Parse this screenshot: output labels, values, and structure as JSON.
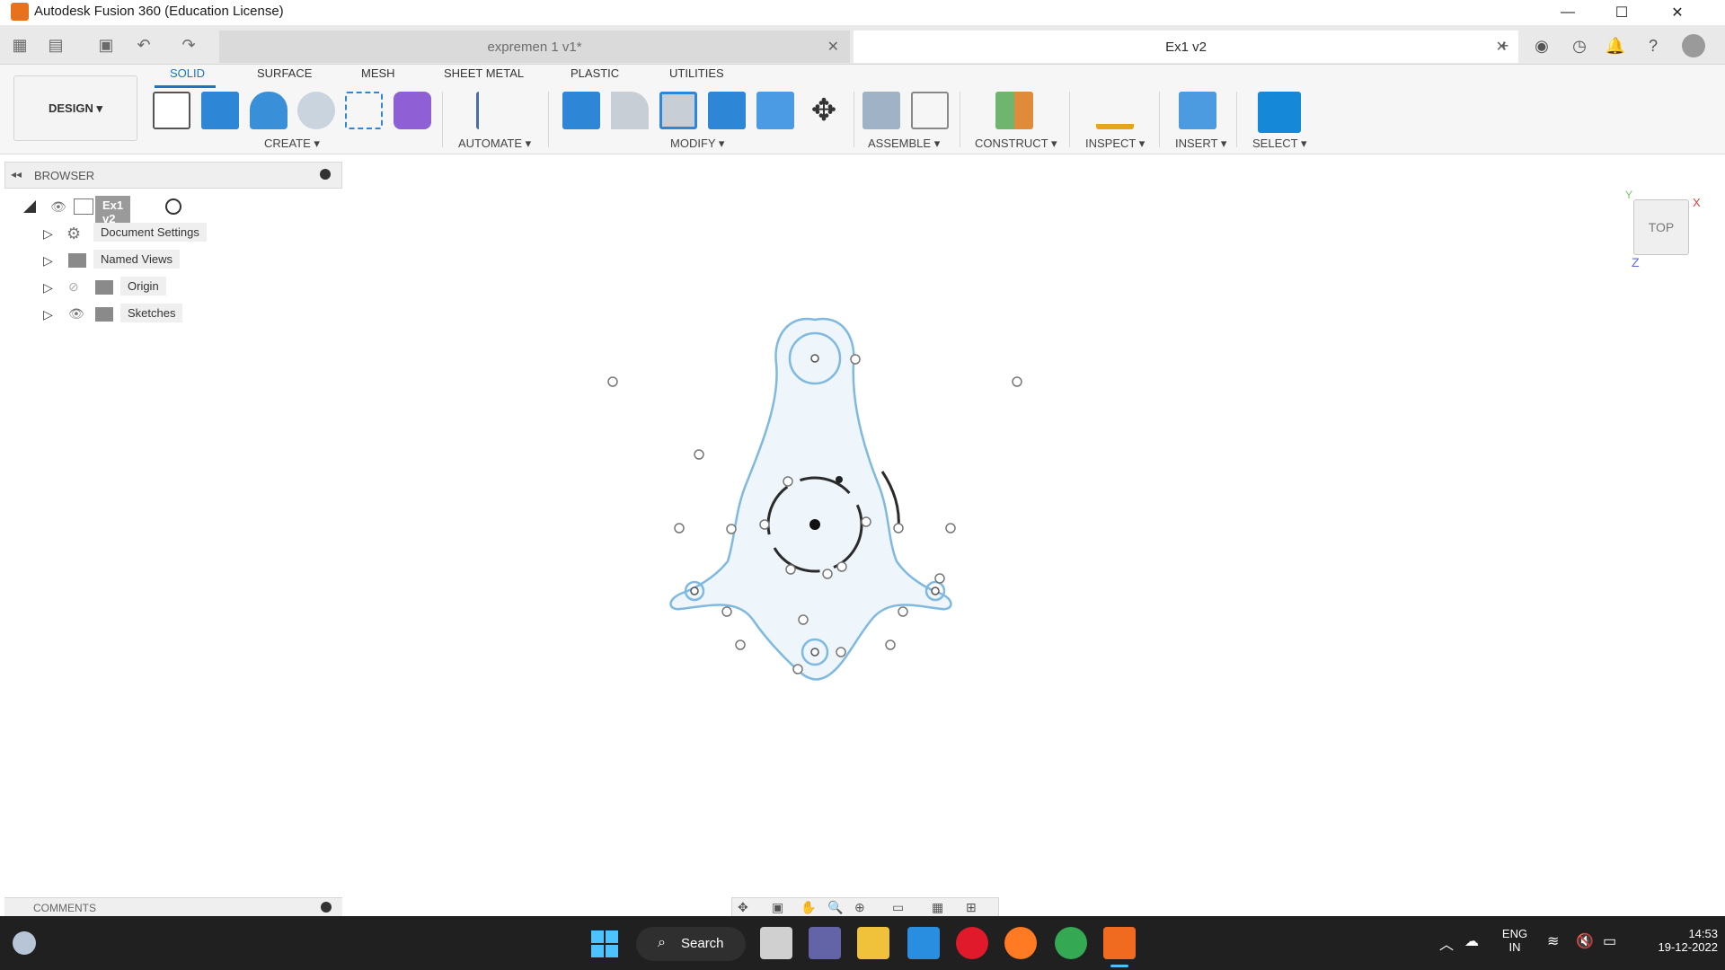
{
  "window": {
    "title": "Autodesk Fusion 360 (Education License)",
    "minimize": "—",
    "maximize": "☐",
    "close": "✕"
  },
  "tabs": [
    {
      "label": "expremen 1 v1*",
      "active": false
    },
    {
      "label": "Ex1 v2",
      "active": true
    }
  ],
  "ribbon": {
    "workspace": "DESIGN ▾",
    "tabs": [
      "SOLID",
      "SURFACE",
      "MESH",
      "SHEET METAL",
      "PLASTIC",
      "UTILITIES"
    ],
    "active_tab": "SOLID",
    "groups": [
      "CREATE ▾",
      "AUTOMATE ▾",
      "MODIFY ▾",
      "ASSEMBLE ▾",
      "CONSTRUCT ▾",
      "INSPECT ▾",
      "INSERT ▾",
      "SELECT ▾"
    ]
  },
  "browser": {
    "title": "BROWSER",
    "root": "Ex1 v2",
    "items": [
      "Document Settings",
      "Named Views",
      "Origin",
      "Sketches"
    ]
  },
  "comments": {
    "label": "COMMENTS"
  },
  "viewcube": {
    "face": "TOP",
    "axis_x": "X",
    "axis_y": "Y",
    "axis_z": "Z"
  },
  "taskbar": {
    "search": "Search",
    "lang_top": "ENG",
    "lang_bottom": "IN",
    "time": "14:53",
    "date": "19-12-2022"
  },
  "colors": {
    "accent": "#1a73c5",
    "sketch_fill": "#eef5fb",
    "sketch_stroke": "#7fb9e0",
    "taskbar": "#202020"
  }
}
